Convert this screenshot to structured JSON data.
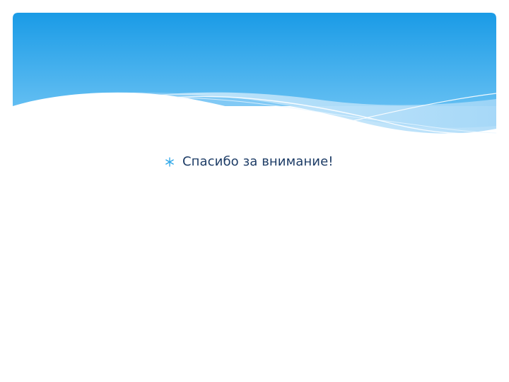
{
  "slide": {
    "bullet_icon": "asterisk-icon",
    "text": "Спасибо за внимание!"
  },
  "colors": {
    "sky_top": "#1a9be6",
    "sky_bottom": "#62bef2",
    "wave_light": "#b9e2fb",
    "text": "#1d3c66",
    "bullet": "#2ba6e8"
  }
}
